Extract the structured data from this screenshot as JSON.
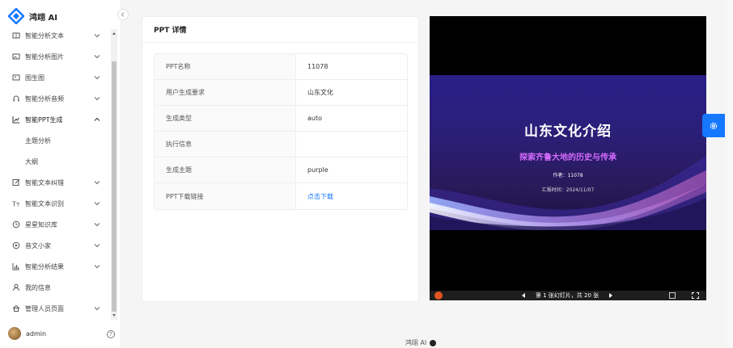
{
  "brand": {
    "name": "鸿翊 AI"
  },
  "sidebar": {
    "items": [
      {
        "label": "智能分析文本",
        "icon": "document-icon",
        "expandable": true
      },
      {
        "label": "智能分析图片",
        "icon": "image-icon",
        "expandable": true
      },
      {
        "label": "图生图",
        "icon": "picture-icon",
        "expandable": true
      },
      {
        "label": "智能分析音频",
        "icon": "headphones-icon",
        "expandable": true
      },
      {
        "label": "智能PPT生成",
        "icon": "line-chart-icon",
        "expandable": true,
        "expanded": true,
        "children": [
          {
            "label": "主题分析"
          },
          {
            "label": "大纲"
          }
        ]
      },
      {
        "label": "智能文本纠错",
        "icon": "edit-icon",
        "expandable": true
      },
      {
        "label": "智能文本识别",
        "icon": "text-icon",
        "expandable": true
      },
      {
        "label": "星星知识库",
        "icon": "clock-icon",
        "expandable": true
      },
      {
        "label": "音文小家",
        "icon": "play-circle-icon",
        "expandable": true
      },
      {
        "label": "智能分析结果",
        "icon": "bar-chart-icon",
        "expandable": true
      },
      {
        "label": "我的信息",
        "icon": "user-icon",
        "expandable": false
      },
      {
        "label": "管理人员页面",
        "icon": "home-icon",
        "expandable": true
      }
    ],
    "user": {
      "name": "admin"
    }
  },
  "details": {
    "title": "PPT 详情",
    "rows": [
      {
        "label": "PPT名称",
        "value": "11078"
      },
      {
        "label": "用户生成要求",
        "value": "山东文化"
      },
      {
        "label": "生成类型",
        "value": "auto"
      },
      {
        "label": "执行信息",
        "value": ""
      },
      {
        "label": "生成主题",
        "value": "purple"
      },
      {
        "label": "PPT下载链接",
        "value": "点击下载",
        "link": true
      }
    ]
  },
  "preview": {
    "slide_title": "山东文化介绍",
    "slide_subtitle": "探索齐鲁大地的历史与传承",
    "slide_author": "作者：11078",
    "slide_date": "汇报时间：2024/11/07",
    "counter": "第 1 张幻灯片，共 20 张",
    "colors": {
      "subtitle": "#d66bff",
      "office": "#e1541f"
    }
  },
  "footer": {
    "text": "鸿翊 AI"
  },
  "colors": {
    "accent": "#1677ff"
  }
}
